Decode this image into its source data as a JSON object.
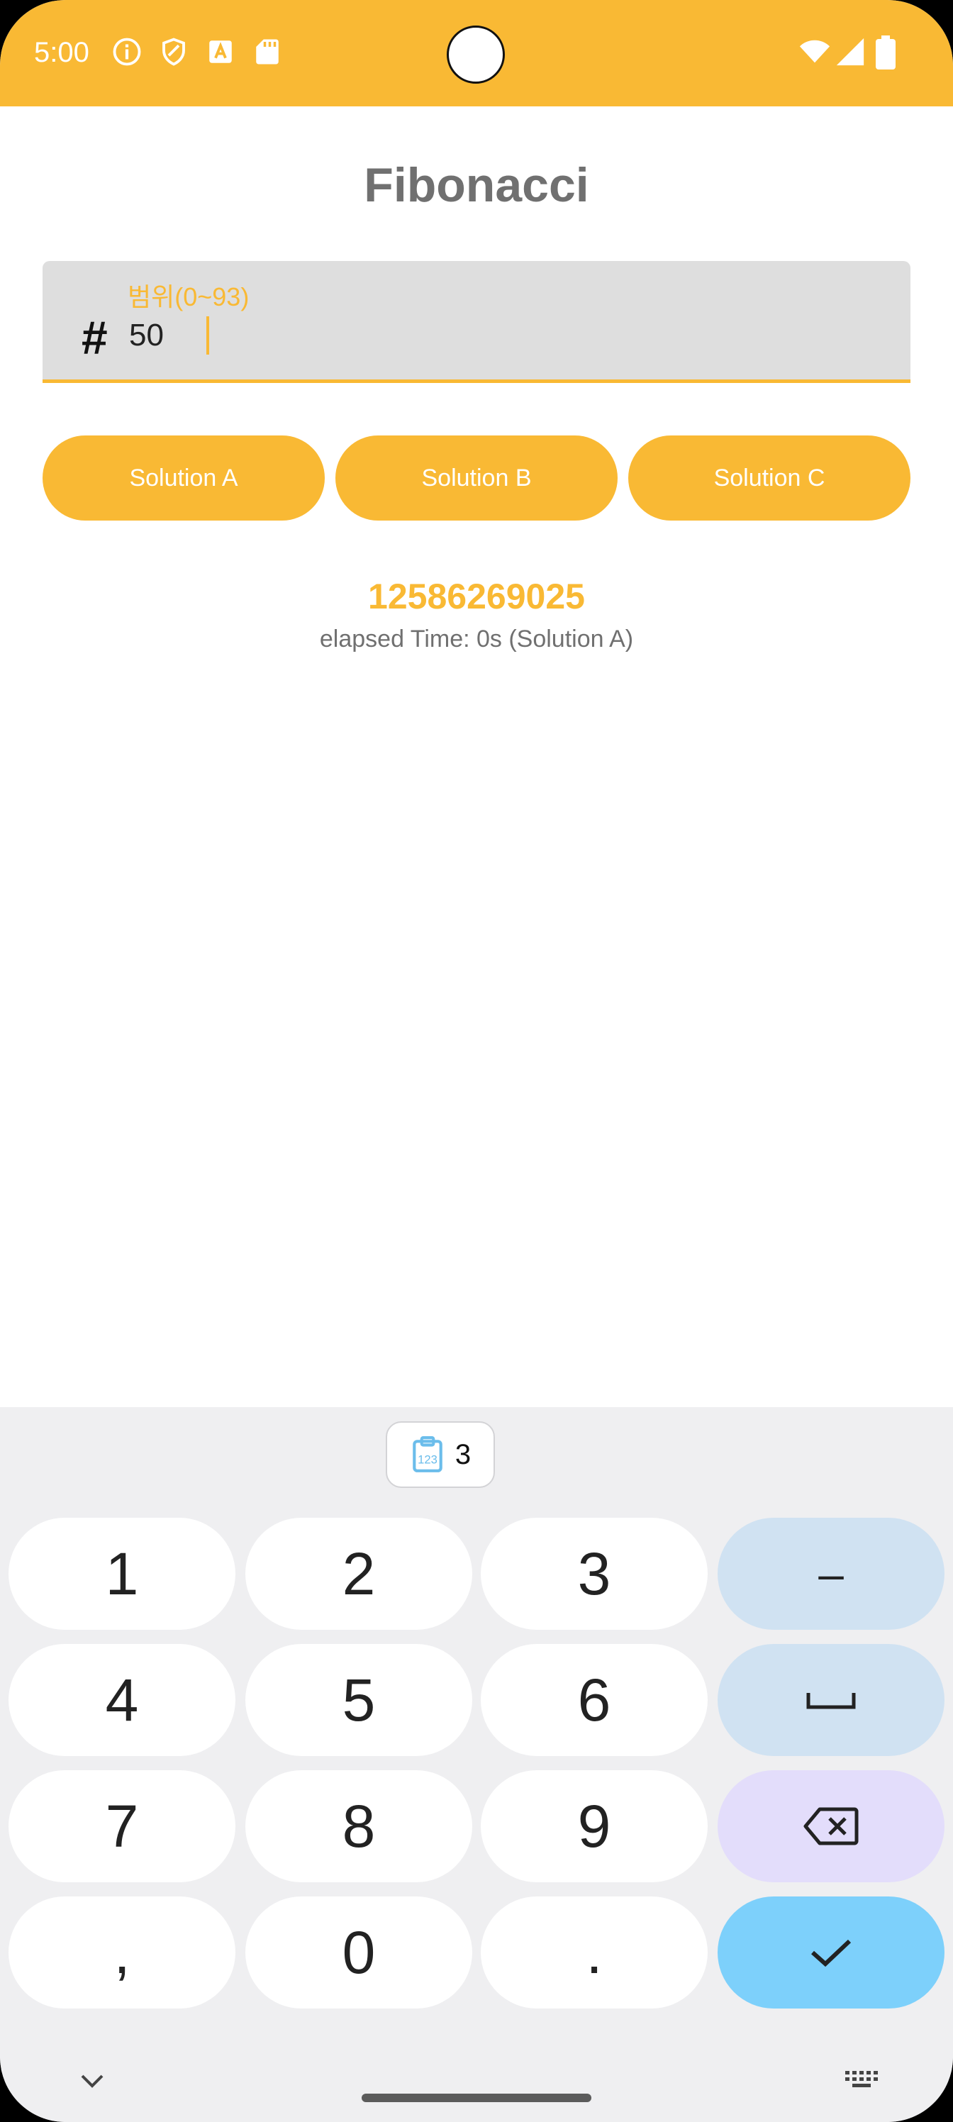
{
  "status_bar": {
    "time": "5:00",
    "icons_left": [
      "info-icon",
      "shield-icon",
      "font-icon",
      "sd-card-icon"
    ],
    "icons_right": [
      "wifi-icon",
      "signal-icon",
      "battery-icon"
    ]
  },
  "app": {
    "title": "Fibonacci",
    "input": {
      "label": "범위(0~93)",
      "value": "50",
      "icon": "hash-icon"
    },
    "buttons": [
      {
        "label": "Solution A"
      },
      {
        "label": "Solution B"
      },
      {
        "label": "Solution C"
      }
    ],
    "result": {
      "value": "12586269025",
      "elapsed": "elapsed Time: 0s (Solution A)"
    }
  },
  "keyboard": {
    "clipboard_count": "3",
    "rows": [
      [
        "1",
        "2",
        "3",
        "–"
      ],
      [
        "4",
        "5",
        "6",
        "␣"
      ],
      [
        "7",
        "8",
        "9",
        "⌫"
      ],
      [
        ",",
        "0",
        ".",
        "✓"
      ]
    ]
  },
  "colors": {
    "accent": "#F9B934",
    "input_bg": "#DEDEDE",
    "keyboard_bg": "#EFEFF1",
    "fn_key": "#D0E2F2",
    "delete_key": "#E3DDFB",
    "enter_key": "#7DD0FB"
  }
}
